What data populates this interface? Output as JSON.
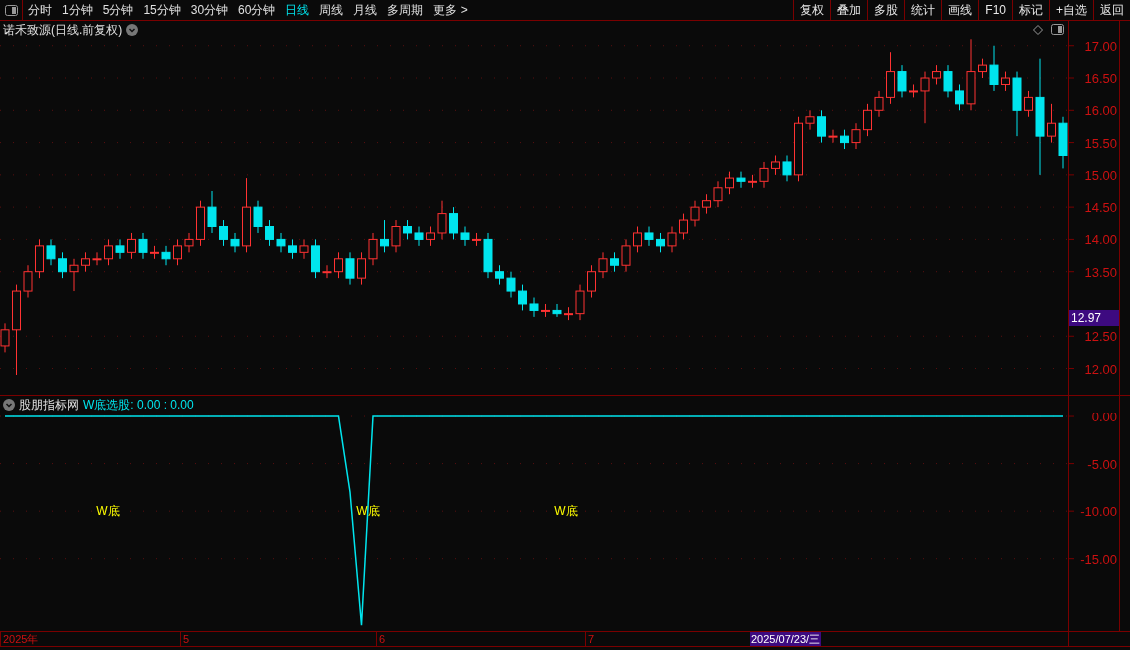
{
  "toolbar": {
    "periods": [
      {
        "label": "分时",
        "selected": false
      },
      {
        "label": "1分钟",
        "selected": false
      },
      {
        "label": "5分钟",
        "selected": false
      },
      {
        "label": "15分钟",
        "selected": false
      },
      {
        "label": "30分钟",
        "selected": false
      },
      {
        "label": "60分钟",
        "selected": false
      },
      {
        "label": "日线",
        "selected": true
      },
      {
        "label": "周线",
        "selected": false
      },
      {
        "label": "月线",
        "selected": false
      },
      {
        "label": "多周期",
        "selected": false
      },
      {
        "label": "更多 >",
        "selected": false
      }
    ],
    "actions": [
      "复权",
      "叠加",
      "多股",
      "统计",
      "画线",
      "F10",
      "标记",
      "+自选",
      "返回"
    ]
  },
  "main_chart": {
    "title": "诺禾致源(日线.前复权)",
    "last_price": "12.97",
    "chart_data": {
      "type": "candlestick",
      "grid": true,
      "ylim": [
        11.59,
        17.12
      ],
      "yticks": [
        {
          "value": 17,
          "label": "17.00"
        },
        {
          "value": 16.5,
          "label": "16.50"
        },
        {
          "value": 16,
          "label": "16.00"
        },
        {
          "value": 15.5,
          "label": "15.50"
        },
        {
          "value": 15,
          "label": "15.00"
        },
        {
          "value": 14.5,
          "label": "14.50"
        },
        {
          "value": 14,
          "label": "14.00"
        },
        {
          "value": 13.5,
          "label": "13.50"
        },
        {
          "value": 12.5,
          "label": "12.50"
        },
        {
          "value": 12,
          "label": "12.00"
        }
      ],
      "ohlc": [
        [
          12.35,
          12.7,
          12.25,
          12.6
        ],
        [
          12.6,
          13.3,
          11.9,
          13.2
        ],
        [
          13.2,
          13.6,
          13.1,
          13.5
        ],
        [
          13.5,
          14.0,
          13.4,
          13.9
        ],
        [
          13.9,
          14.0,
          13.6,
          13.7
        ],
        [
          13.7,
          13.8,
          13.4,
          13.5
        ],
        [
          13.5,
          13.7,
          13.2,
          13.6
        ],
        [
          13.6,
          13.8,
          13.5,
          13.7
        ],
        [
          13.7,
          13.8,
          13.6,
          13.7
        ],
        [
          13.7,
          14.0,
          13.6,
          13.9
        ],
        [
          13.9,
          14.0,
          13.7,
          13.8
        ],
        [
          13.8,
          14.1,
          13.7,
          14.0
        ],
        [
          14.0,
          14.1,
          13.7,
          13.8
        ],
        [
          13.8,
          13.9,
          13.7,
          13.8
        ],
        [
          13.8,
          13.9,
          13.6,
          13.7
        ],
        [
          13.7,
          14.0,
          13.6,
          13.9
        ],
        [
          13.9,
          14.1,
          13.8,
          14.0
        ],
        [
          14.0,
          14.6,
          13.9,
          14.5
        ],
        [
          14.5,
          14.75,
          14.1,
          14.2
        ],
        [
          14.2,
          14.3,
          13.9,
          14.0
        ],
        [
          14.0,
          14.1,
          13.8,
          13.9
        ],
        [
          13.9,
          14.95,
          13.8,
          14.5
        ],
        [
          14.5,
          14.6,
          14.1,
          14.2
        ],
        [
          14.2,
          14.3,
          13.9,
          14.0
        ],
        [
          14.0,
          14.1,
          13.8,
          13.9
        ],
        [
          13.9,
          14.0,
          13.7,
          13.8
        ],
        [
          13.8,
          14.0,
          13.7,
          13.9
        ],
        [
          13.9,
          14.0,
          13.4,
          13.5
        ],
        [
          13.5,
          13.6,
          13.4,
          13.5
        ],
        [
          13.5,
          13.8,
          13.4,
          13.7
        ],
        [
          13.7,
          13.8,
          13.3,
          13.4
        ],
        [
          13.4,
          13.8,
          13.3,
          13.7
        ],
        [
          13.7,
          14.1,
          13.6,
          14.0
        ],
        [
          14.0,
          14.3,
          13.8,
          13.9
        ],
        [
          13.9,
          14.3,
          13.8,
          14.2
        ],
        [
          14.2,
          14.3,
          14.0,
          14.1
        ],
        [
          14.1,
          14.2,
          13.9,
          14.0
        ],
        [
          14.0,
          14.2,
          13.9,
          14.1
        ],
        [
          14.1,
          14.6,
          14.0,
          14.4
        ],
        [
          14.4,
          14.5,
          14.0,
          14.1
        ],
        [
          14.1,
          14.2,
          13.9,
          14.0
        ],
        [
          14.0,
          14.1,
          13.9,
          14.0
        ],
        [
          14.0,
          14.1,
          13.4,
          13.5
        ],
        [
          13.5,
          13.6,
          13.3,
          13.4
        ],
        [
          13.4,
          13.5,
          13.1,
          13.2
        ],
        [
          13.2,
          13.3,
          12.9,
          13.0
        ],
        [
          13.0,
          13.1,
          12.8,
          12.9
        ],
        [
          12.9,
          13.0,
          12.8,
          12.9
        ],
        [
          12.9,
          13.0,
          12.8,
          12.85
        ],
        [
          12.85,
          12.95,
          12.75,
          12.85
        ],
        [
          12.85,
          13.3,
          12.75,
          13.2
        ],
        [
          13.2,
          13.6,
          13.1,
          13.5
        ],
        [
          13.5,
          13.8,
          13.4,
          13.7
        ],
        [
          13.7,
          13.8,
          13.5,
          13.6
        ],
        [
          13.6,
          14.0,
          13.5,
          13.9
        ],
        [
          13.9,
          14.2,
          13.8,
          14.1
        ],
        [
          14.1,
          14.2,
          13.9,
          14.0
        ],
        [
          14.0,
          14.1,
          13.8,
          13.9
        ],
        [
          13.9,
          14.2,
          13.8,
          14.1
        ],
        [
          14.1,
          14.4,
          14.0,
          14.3
        ],
        [
          14.3,
          14.6,
          14.2,
          14.5
        ],
        [
          14.5,
          14.7,
          14.4,
          14.6
        ],
        [
          14.6,
          14.9,
          14.5,
          14.8
        ],
        [
          14.8,
          15.05,
          14.7,
          14.95
        ],
        [
          14.95,
          15.05,
          14.8,
          14.9
        ],
        [
          14.9,
          15.0,
          14.8,
          14.9
        ],
        [
          14.9,
          15.2,
          14.8,
          15.1
        ],
        [
          15.1,
          15.3,
          15.0,
          15.2
        ],
        [
          15.2,
          15.3,
          14.9,
          15.0
        ],
        [
          15.0,
          15.9,
          14.9,
          15.8
        ],
        [
          15.8,
          16.0,
          15.7,
          15.9
        ],
        [
          15.9,
          16.0,
          15.5,
          15.6
        ],
        [
          15.6,
          15.7,
          15.5,
          15.6
        ],
        [
          15.6,
          15.7,
          15.4,
          15.5
        ],
        [
          15.5,
          15.8,
          15.4,
          15.7
        ],
        [
          15.7,
          16.1,
          15.6,
          16.0
        ],
        [
          16.0,
          16.3,
          15.9,
          16.2
        ],
        [
          16.2,
          16.9,
          16.1,
          16.6
        ],
        [
          16.6,
          16.7,
          16.2,
          16.3
        ],
        [
          16.3,
          16.4,
          16.2,
          16.3
        ],
        [
          16.3,
          16.6,
          15.8,
          16.5
        ],
        [
          16.5,
          16.7,
          16.4,
          16.6
        ],
        [
          16.6,
          16.7,
          16.2,
          16.3
        ],
        [
          16.3,
          16.4,
          16.0,
          16.1
        ],
        [
          16.1,
          17.1,
          16.0,
          16.6
        ],
        [
          16.6,
          16.8,
          16.5,
          16.7
        ],
        [
          16.7,
          17.0,
          16.3,
          16.4
        ],
        [
          16.4,
          16.6,
          16.3,
          16.5
        ],
        [
          16.5,
          16.6,
          15.6,
          16.0
        ],
        [
          16.0,
          16.3,
          15.9,
          16.2
        ],
        [
          16.2,
          16.8,
          15.0,
          15.6
        ],
        [
          15.6,
          16.1,
          15.5,
          15.8
        ],
        [
          15.8,
          15.9,
          15.1,
          15.3
        ]
      ]
    }
  },
  "indicator": {
    "name": "股朋指标网",
    "readout": ": 0.00 : 0.00",
    "signals": [
      "W底",
      "W底",
      "W底"
    ],
    "chart_data": {
      "type": "line",
      "grid": true,
      "ylim": [
        -22.6,
        0.32
      ],
      "yticks": [
        {
          "value": 0,
          "label": "0.00"
        },
        {
          "value": -5,
          "label": "-5.00"
        },
        {
          "value": -10,
          "label": "-10.00"
        },
        {
          "value": -15,
          "label": "-15.00"
        }
      ],
      "series": [
        {
          "name": "W底选股",
          "color": "#00e5ee",
          "values": [
            0,
            0,
            0,
            0,
            0,
            0,
            0,
            0,
            0,
            0,
            0,
            0,
            0,
            0,
            0,
            0,
            0,
            0,
            0,
            0,
            0,
            0,
            0,
            0,
            0,
            0,
            0,
            0,
            0,
            0,
            -8,
            -22,
            0,
            0,
            0,
            0,
            0,
            0,
            0,
            0,
            0,
            0,
            0,
            0,
            0,
            0,
            0,
            0,
            0,
            0,
            0,
            0,
            0,
            0,
            0,
            0,
            0,
            0,
            0,
            0,
            0,
            0,
            0,
            0,
            0,
            0,
            0,
            0,
            0,
            0,
            0,
            0,
            0,
            0,
            0,
            0,
            0,
            0,
            0,
            0,
            0,
            0,
            0,
            0,
            0,
            0,
            0,
            0,
            0,
            0,
            0,
            0,
            0
          ]
        }
      ]
    }
  },
  "date_axis": {
    "labels": [
      "2025年",
      "5",
      "6",
      "7"
    ],
    "cursor": "2025/07/23/三"
  }
}
